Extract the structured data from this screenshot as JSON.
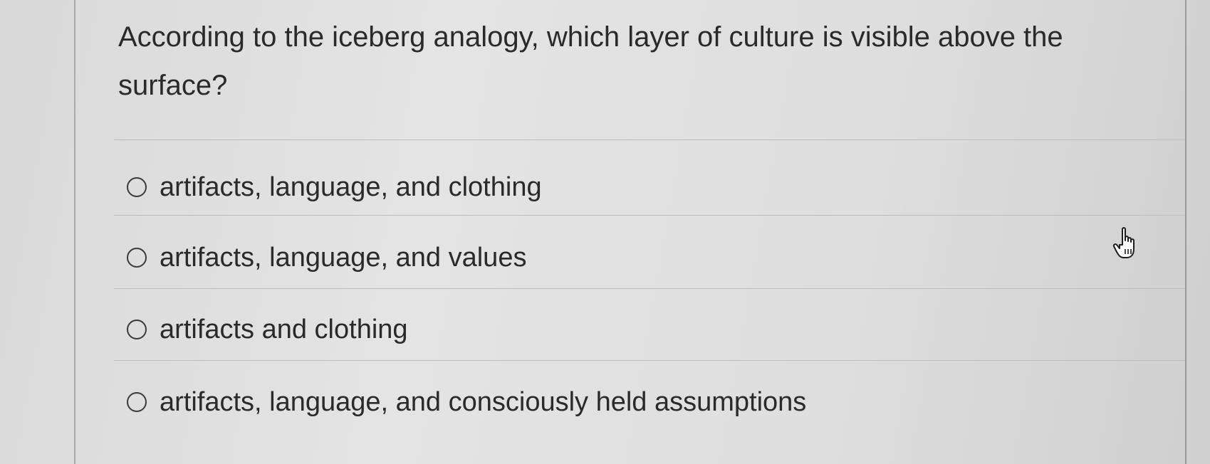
{
  "question": {
    "text": "According to the iceberg analogy, which layer of culture is visible above the surface?"
  },
  "options": [
    {
      "label": "artifacts, language, and clothing",
      "selected": false
    },
    {
      "label": "artifacts, language, and values",
      "selected": false
    },
    {
      "label": "artifacts and clothing",
      "selected": false
    },
    {
      "label": "artifacts, language, and consciously held assumptions",
      "selected": false
    }
  ],
  "cursor": {
    "icon": "hand-pointer-icon"
  }
}
